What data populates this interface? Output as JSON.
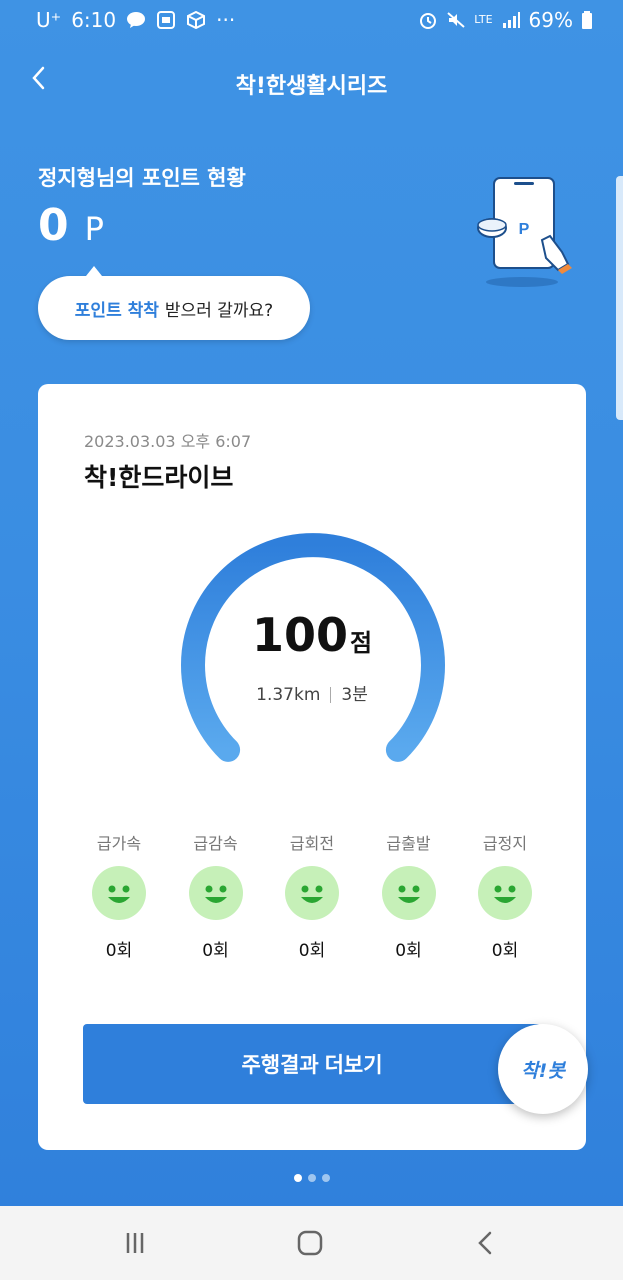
{
  "status_bar": {
    "carrier": "U⁺",
    "time": "6:10",
    "ellipsis": "···",
    "network": "LTE",
    "battery": "69%"
  },
  "header": {
    "title": "착!한생활시리즈"
  },
  "points": {
    "owner_label": "정지형님의 포인트 현황",
    "value": "0",
    "unit": "P"
  },
  "promo": {
    "highlight": "포인트 착착",
    "text": "받으러 갈까요?"
  },
  "drive_card": {
    "date": "2023.03.03 오후 6:07",
    "title": "착!한드라이브",
    "score": "100",
    "score_unit": "점",
    "score_fraction": 1.0,
    "distance": "1.37km",
    "duration": "3분",
    "events": [
      {
        "label": "급가속",
        "count": "0회"
      },
      {
        "label": "급감속",
        "count": "0회"
      },
      {
        "label": "급회전",
        "count": "0회"
      },
      {
        "label": "급출발",
        "count": "0회"
      },
      {
        "label": "급정지",
        "count": "0회"
      }
    ],
    "more_button": "주행결과 더보기"
  },
  "fab_label": "착!봇",
  "illustration_badge": "P",
  "pager": {
    "count": 3,
    "active": 0
  },
  "colors": {
    "brand_blue": "#2f7fdb",
    "background": "#3f93e4",
    "face_green": "#c6f0b8",
    "face_feature": "#2aa632"
  }
}
